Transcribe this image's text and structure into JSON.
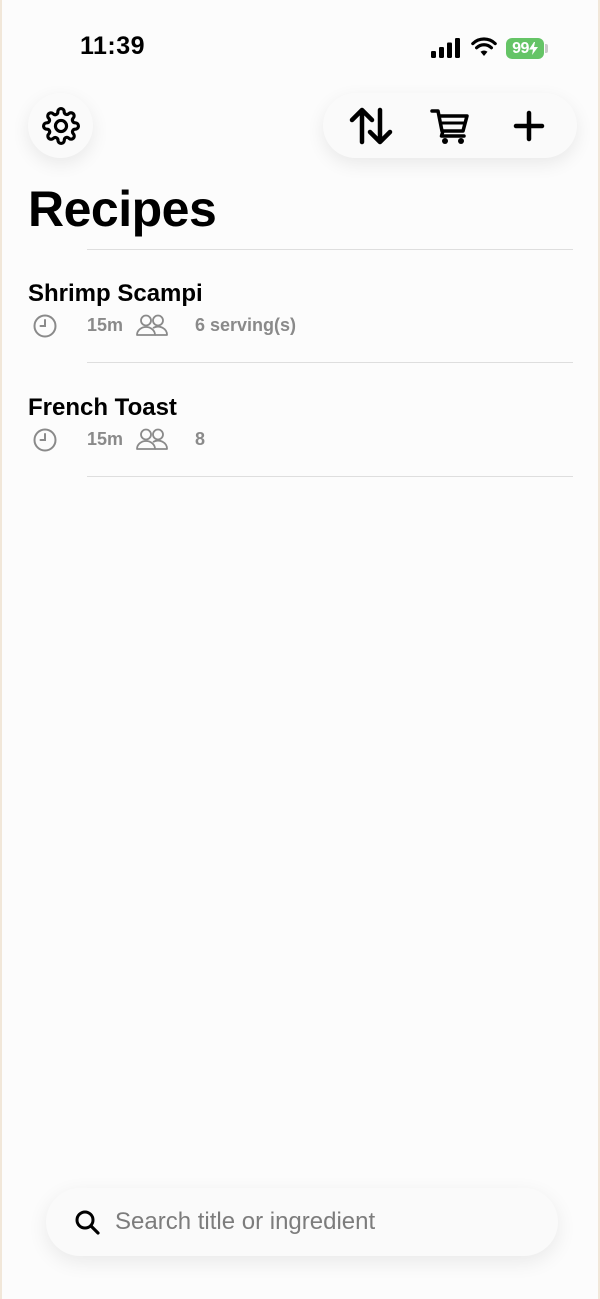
{
  "status_bar": {
    "time": "11:39",
    "battery": "99",
    "battery_color": "#65c466"
  },
  "header": {
    "settings_icon": "gear-icon",
    "sort_icon": "sort-arrows-icon",
    "cart_icon": "cart-icon",
    "add_icon": "plus-icon",
    "title": "Recipes"
  },
  "recipes": [
    {
      "title": "Shrimp Scampi",
      "time": "15m",
      "servings": "6 serving(s)"
    },
    {
      "title": "French Toast",
      "time": "15m",
      "servings": "8"
    }
  ],
  "search": {
    "placeholder": "Search title or ingredient",
    "value": ""
  }
}
